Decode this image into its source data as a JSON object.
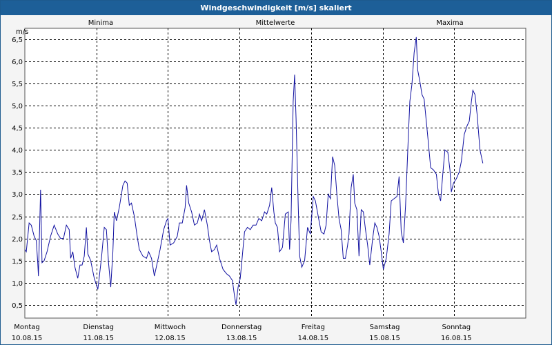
{
  "window": {
    "title": "Windgeschwindigkeit [m/s] skaliert"
  },
  "colors": {
    "minima": "#22aa22",
    "mittelwerte": "#3a2ad8",
    "maxima": "#cc2222",
    "series": "#1010a0",
    "grid": "#000000",
    "titlebar": "#1d5f98"
  },
  "chart_data": {
    "type": "line",
    "title": "Windgeschwindigkeit [m/s] skaliert",
    "ylabel": "m/s",
    "ylim": [
      0.2,
      6.75
    ],
    "xlim": [
      0,
      7
    ],
    "yticks": [
      "0,5",
      "1,0",
      "1,5",
      "2,0",
      "2,5",
      "3,0",
      "3,5",
      "4,0",
      "4,5",
      "5,0",
      "5,5",
      "6,0",
      "6,5"
    ],
    "ytick_values": [
      0.5,
      1.0,
      1.5,
      2.0,
      2.5,
      3.0,
      3.5,
      4.0,
      4.5,
      5.0,
      5.5,
      6.0,
      6.5
    ],
    "grid": true,
    "legend": [
      {
        "label": "Minima",
        "color": "#22aa22"
      },
      {
        "label": "Mittelwerte",
        "color": "#3a2ad8"
      },
      {
        "label": "Maxima",
        "color": "#cc2222"
      }
    ],
    "days": [
      {
        "name": "Montag",
        "date": "10.08.15"
      },
      {
        "name": "Dienstag",
        "date": "11.08.15"
      },
      {
        "name": "Mittwoch",
        "date": "12.08.15"
      },
      {
        "name": "Donnerstag",
        "date": "13.08.15"
      },
      {
        "name": "Freitag",
        "date": "14.08.15"
      },
      {
        "name": "Samstag",
        "date": "15.08.15"
      },
      {
        "name": "Sonntag",
        "date": "16.08.15"
      }
    ],
    "series": [
      {
        "values": [
          [
            0.0,
            1.75
          ],
          [
            0.02,
            1.7
          ],
          [
            0.06,
            2.35
          ],
          [
            0.09,
            2.3
          ],
          [
            0.13,
            2.05
          ],
          [
            0.16,
            1.95
          ],
          [
            0.18,
            1.45
          ],
          [
            0.19,
            1.15
          ],
          [
            0.22,
            3.1
          ],
          [
            0.24,
            1.45
          ],
          [
            0.27,
            1.5
          ],
          [
            0.31,
            1.7
          ],
          [
            0.36,
            2.05
          ],
          [
            0.41,
            2.3
          ],
          [
            0.46,
            2.1
          ],
          [
            0.5,
            2.0
          ],
          [
            0.54,
            2.0
          ],
          [
            0.58,
            2.3
          ],
          [
            0.62,
            2.2
          ],
          [
            0.64,
            1.55
          ],
          [
            0.67,
            1.7
          ],
          [
            0.7,
            1.35
          ],
          [
            0.74,
            1.1
          ],
          [
            0.77,
            1.4
          ],
          [
            0.8,
            1.4
          ],
          [
            0.83,
            1.6
          ],
          [
            0.86,
            2.25
          ],
          [
            0.88,
            1.65
          ],
          [
            0.92,
            1.5
          ],
          [
            0.97,
            1.1
          ],
          [
            1.02,
            0.85
          ],
          [
            1.07,
            1.55
          ],
          [
            1.11,
            2.25
          ],
          [
            1.14,
            2.2
          ],
          [
            1.17,
            1.45
          ],
          [
            1.2,
            0.9
          ],
          [
            1.23,
            1.7
          ],
          [
            1.25,
            2.6
          ],
          [
            1.28,
            2.4
          ],
          [
            1.32,
            2.7
          ],
          [
            1.37,
            3.2
          ],
          [
            1.4,
            3.3
          ],
          [
            1.43,
            3.25
          ],
          [
            1.46,
            2.75
          ],
          [
            1.49,
            2.8
          ],
          [
            1.53,
            2.5
          ],
          [
            1.57,
            2.05
          ],
          [
            1.6,
            1.75
          ],
          [
            1.65,
            1.6
          ],
          [
            1.7,
            1.55
          ],
          [
            1.73,
            1.7
          ],
          [
            1.77,
            1.55
          ],
          [
            1.81,
            1.15
          ],
          [
            1.85,
            1.45
          ],
          [
            1.89,
            1.75
          ],
          [
            1.94,
            2.2
          ],
          [
            1.98,
            2.4
          ],
          [
            2.0,
            2.45
          ],
          [
            2.03,
            1.85
          ],
          [
            2.08,
            1.9
          ],
          [
            2.13,
            2.05
          ],
          [
            2.16,
            2.35
          ],
          [
            2.2,
            2.35
          ],
          [
            2.24,
            2.7
          ],
          [
            2.26,
            3.2
          ],
          [
            2.29,
            2.8
          ],
          [
            2.33,
            2.6
          ],
          [
            2.37,
            2.3
          ],
          [
            2.41,
            2.35
          ],
          [
            2.44,
            2.55
          ],
          [
            2.47,
            2.4
          ],
          [
            2.51,
            2.65
          ],
          [
            2.55,
            2.3
          ],
          [
            2.58,
            1.95
          ],
          [
            2.61,
            1.7
          ],
          [
            2.65,
            1.75
          ],
          [
            2.68,
            1.85
          ],
          [
            2.72,
            1.55
          ],
          [
            2.77,
            1.3
          ],
          [
            2.82,
            1.2
          ],
          [
            2.86,
            1.15
          ],
          [
            2.9,
            1.05
          ],
          [
            2.93,
            0.7
          ],
          [
            2.95,
            0.5
          ],
          [
            2.98,
            0.9
          ],
          [
            3.01,
            1.1
          ],
          [
            3.03,
            1.45
          ],
          [
            3.07,
            2.15
          ],
          [
            3.11,
            2.25
          ],
          [
            3.15,
            2.2
          ],
          [
            3.19,
            2.3
          ],
          [
            3.23,
            2.3
          ],
          [
            3.27,
            2.45
          ],
          [
            3.31,
            2.4
          ],
          [
            3.35,
            2.6
          ],
          [
            3.38,
            2.55
          ],
          [
            3.42,
            2.75
          ],
          [
            3.45,
            3.15
          ],
          [
            3.48,
            2.6
          ],
          [
            3.5,
            2.35
          ],
          [
            3.53,
            2.25
          ],
          [
            3.56,
            1.7
          ],
          [
            3.6,
            1.8
          ],
          [
            3.64,
            2.55
          ],
          [
            3.68,
            2.6
          ],
          [
            3.7,
            1.75
          ],
          [
            3.72,
            2.4
          ],
          [
            3.75,
            5.1
          ],
          [
            3.77,
            5.7
          ],
          [
            3.79,
            4.7
          ],
          [
            3.82,
            2.75
          ],
          [
            3.84,
            1.6
          ],
          [
            3.87,
            1.35
          ],
          [
            3.91,
            1.5
          ],
          [
            3.95,
            2.25
          ],
          [
            3.99,
            2.1
          ],
          [
            4.03,
            2.95
          ],
          [
            4.06,
            2.85
          ],
          [
            4.1,
            2.5
          ],
          [
            4.14,
            2.15
          ],
          [
            4.18,
            2.1
          ],
          [
            4.21,
            2.3
          ],
          [
            4.24,
            3.0
          ],
          [
            4.27,
            2.9
          ],
          [
            4.3,
            3.85
          ],
          [
            4.33,
            3.65
          ],
          [
            4.36,
            3.0
          ],
          [
            4.39,
            2.45
          ],
          [
            4.42,
            2.2
          ],
          [
            4.45,
            1.55
          ],
          [
            4.48,
            1.55
          ],
          [
            4.51,
            1.85
          ],
          [
            4.53,
            2.1
          ],
          [
            4.56,
            3.15
          ],
          [
            4.59,
            3.45
          ],
          [
            4.61,
            2.8
          ],
          [
            4.64,
            2.65
          ],
          [
            4.67,
            1.6
          ],
          [
            4.7,
            2.65
          ],
          [
            4.73,
            2.6
          ],
          [
            4.76,
            2.2
          ],
          [
            4.79,
            1.85
          ],
          [
            4.82,
            1.4
          ],
          [
            4.86,
            2.0
          ],
          [
            4.89,
            2.35
          ],
          [
            4.92,
            2.25
          ],
          [
            4.95,
            2.05
          ],
          [
            4.98,
            1.7
          ],
          [
            5.01,
            1.3
          ],
          [
            5.05,
            1.55
          ],
          [
            5.09,
            2.1
          ],
          [
            5.12,
            2.85
          ],
          [
            5.16,
            2.9
          ],
          [
            5.2,
            2.95
          ],
          [
            5.23,
            3.4
          ],
          [
            5.26,
            2.15
          ],
          [
            5.29,
            1.9
          ],
          [
            5.32,
            2.75
          ],
          [
            5.36,
            4.35
          ],
          [
            5.38,
            5.1
          ],
          [
            5.41,
            5.5
          ],
          [
            5.44,
            6.2
          ],
          [
            5.47,
            6.55
          ],
          [
            5.49,
            5.8
          ],
          [
            5.52,
            5.55
          ],
          [
            5.55,
            5.25
          ],
          [
            5.58,
            5.15
          ],
          [
            5.61,
            4.65
          ],
          [
            5.64,
            4.15
          ],
          [
            5.67,
            3.6
          ],
          [
            5.71,
            3.55
          ],
          [
            5.75,
            3.45
          ],
          [
            5.78,
            3.0
          ],
          [
            5.81,
            2.85
          ],
          [
            5.84,
            3.45
          ],
          [
            5.87,
            4.0
          ],
          [
            5.91,
            3.95
          ],
          [
            5.94,
            3.55
          ],
          [
            5.96,
            3.05
          ],
          [
            5.99,
            3.25
          ],
          [
            6.03,
            3.35
          ],
          [
            6.07,
            3.5
          ],
          [
            6.1,
            3.75
          ],
          [
            6.14,
            4.35
          ],
          [
            6.18,
            4.55
          ],
          [
            6.21,
            4.65
          ],
          [
            6.24,
            5.1
          ],
          [
            6.26,
            5.35
          ],
          [
            6.29,
            5.25
          ],
          [
            6.32,
            4.8
          ],
          [
            6.36,
            4.0
          ],
          [
            6.4,
            3.7
          ]
        ]
      }
    ]
  }
}
